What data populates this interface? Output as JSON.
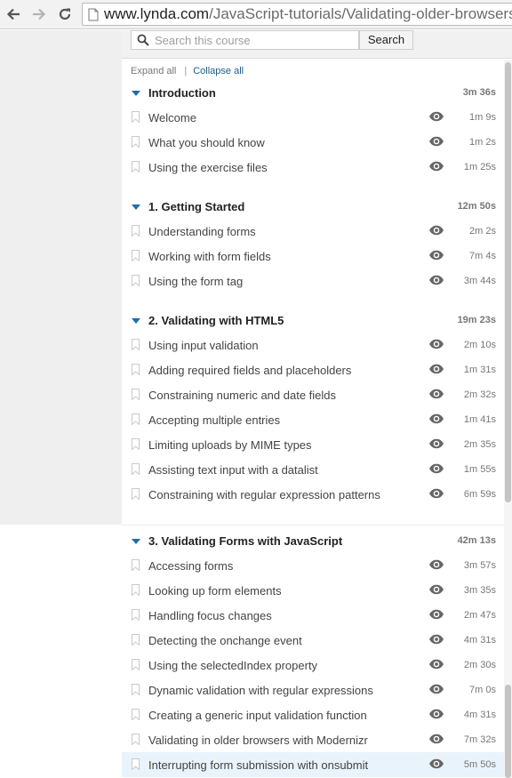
{
  "browser": {
    "url_host": "www.lynda.com",
    "url_path": "/JavaScript-tutorials/Validating-older-browsers-Mo"
  },
  "search": {
    "placeholder": "Search this course",
    "button_label": "Search"
  },
  "toc": {
    "expand_all": "Expand all",
    "separator": "|",
    "collapse_all": "Collapse all",
    "chapters": [
      {
        "title": "Introduction",
        "duration": "3m 36s",
        "videos": [
          {
            "title": "Welcome",
            "duration": "1m 9s",
            "watched": true
          },
          {
            "title": "What you should know",
            "duration": "1m 2s",
            "watched": true
          },
          {
            "title": "Using the exercise files",
            "duration": "1m 25s",
            "watched": true
          }
        ]
      },
      {
        "title": "1. Getting Started",
        "duration": "12m 50s",
        "videos": [
          {
            "title": "Understanding forms",
            "duration": "2m 2s",
            "watched": true
          },
          {
            "title": "Working with form fields",
            "duration": "7m 4s",
            "watched": true
          },
          {
            "title": "Using the form tag",
            "duration": "3m 44s",
            "watched": true
          }
        ]
      },
      {
        "title": "2. Validating with HTML5",
        "duration": "19m 23s",
        "videos": [
          {
            "title": "Using input validation",
            "duration": "2m 10s",
            "watched": true
          },
          {
            "title": "Adding required fields and placeholders",
            "duration": "1m 31s",
            "watched": true
          },
          {
            "title": "Constraining numeric and date fields",
            "duration": "2m 32s",
            "watched": true
          },
          {
            "title": "Accepting multiple entries",
            "duration": "1m 41s",
            "watched": true
          },
          {
            "title": "Limiting uploads by MIME types",
            "duration": "2m 35s",
            "watched": true
          },
          {
            "title": "Assisting text input with a datalist",
            "duration": "1m 55s",
            "watched": true
          },
          {
            "title": "Constraining with regular expression patterns",
            "duration": "6m 59s",
            "watched": true
          }
        ]
      },
      {
        "title": "3. Validating Forms with JavaScript",
        "duration": "42m 13s",
        "videos": [
          {
            "title": "Accessing forms",
            "duration": "3m 57s",
            "watched": true
          },
          {
            "title": "Looking up form elements",
            "duration": "3m 35s",
            "watched": true
          },
          {
            "title": "Handling focus changes",
            "duration": "2m 47s",
            "watched": true
          },
          {
            "title": "Detecting the onchange event",
            "duration": "4m 31s",
            "watched": true
          },
          {
            "title": "Using the selectedIndex property",
            "duration": "2m 30s",
            "watched": true
          },
          {
            "title": "Dynamic validation with regular expressions",
            "duration": "7m 0s",
            "watched": true
          },
          {
            "title": "Creating a generic input validation function",
            "duration": "4m 31s",
            "watched": true
          },
          {
            "title": "Validating in older browsers with Modernizr",
            "duration": "7m 32s",
            "watched": true
          },
          {
            "title": "Interrupting form submission with onsubmit",
            "duration": "5m 50s",
            "watched": true,
            "highlighted": true
          }
        ]
      }
    ]
  },
  "colors": {
    "accent": "#1d6ea8",
    "highlight_row": "#e9f3fb"
  }
}
